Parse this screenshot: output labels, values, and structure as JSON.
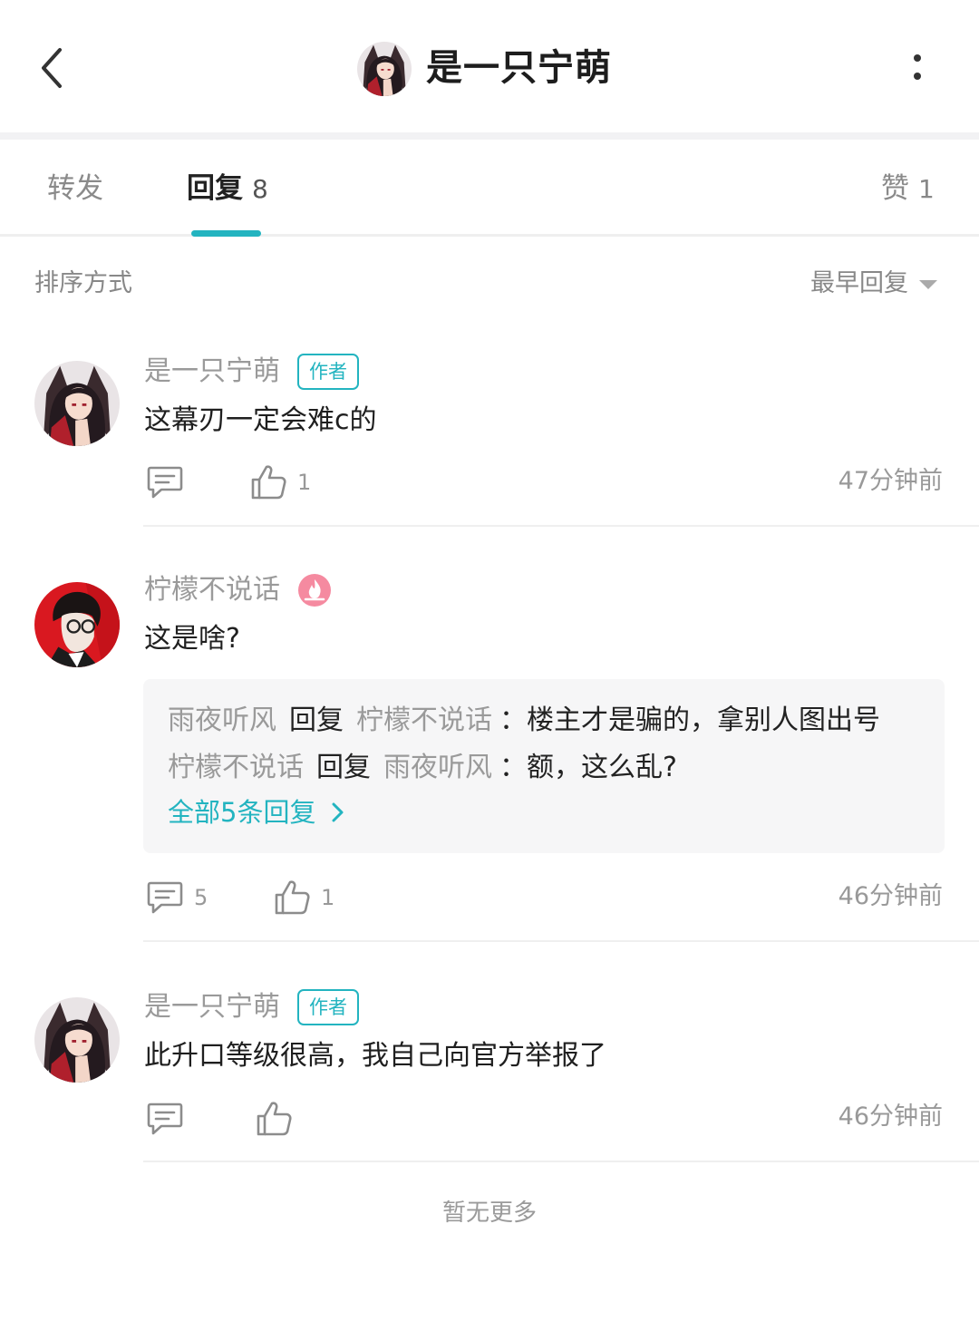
{
  "header": {
    "title": "是一只宁萌",
    "back_icon": "chevron-left-icon",
    "more_icon": "more-vertical-icon"
  },
  "tabs": {
    "forward": {
      "label": "转发"
    },
    "reply": {
      "label": "回复",
      "count": "8"
    },
    "like": {
      "label": "赞",
      "count": "1"
    }
  },
  "sort": {
    "label": "排序方式",
    "selected": "最早回复"
  },
  "comments": [
    {
      "username": "是一只宁萌",
      "badge": "作者",
      "text": "这幕刃一定会难c的",
      "reply_count": "",
      "like_count": "1",
      "time": "47分钟前"
    },
    {
      "username": "柠檬不说话",
      "text": "这是啥?",
      "replies": [
        {
          "from": "雨夜听风",
          "verb": "回复",
          "to": "柠檬不说话",
          "text": "：楼主才是骗的，拿别人图出号"
        },
        {
          "from": "柠檬不说话",
          "verb": "回复",
          "to": "雨夜听风",
          "text": "：额，这么乱?"
        }
      ],
      "view_all": "全部5条回复",
      "reply_count": "5",
      "like_count": "1",
      "time": "46分钟前"
    },
    {
      "username": "是一只宁萌",
      "badge": "作者",
      "text": "此升口等级很高，我自己向官方举报了",
      "reply_count": "",
      "like_count": "",
      "time": "46分钟前"
    }
  ],
  "footer": {
    "no_more": "暂无更多"
  },
  "colors": {
    "accent": "#23b4c0",
    "muted": "#999999",
    "badge_fire": "#f58aa0"
  }
}
